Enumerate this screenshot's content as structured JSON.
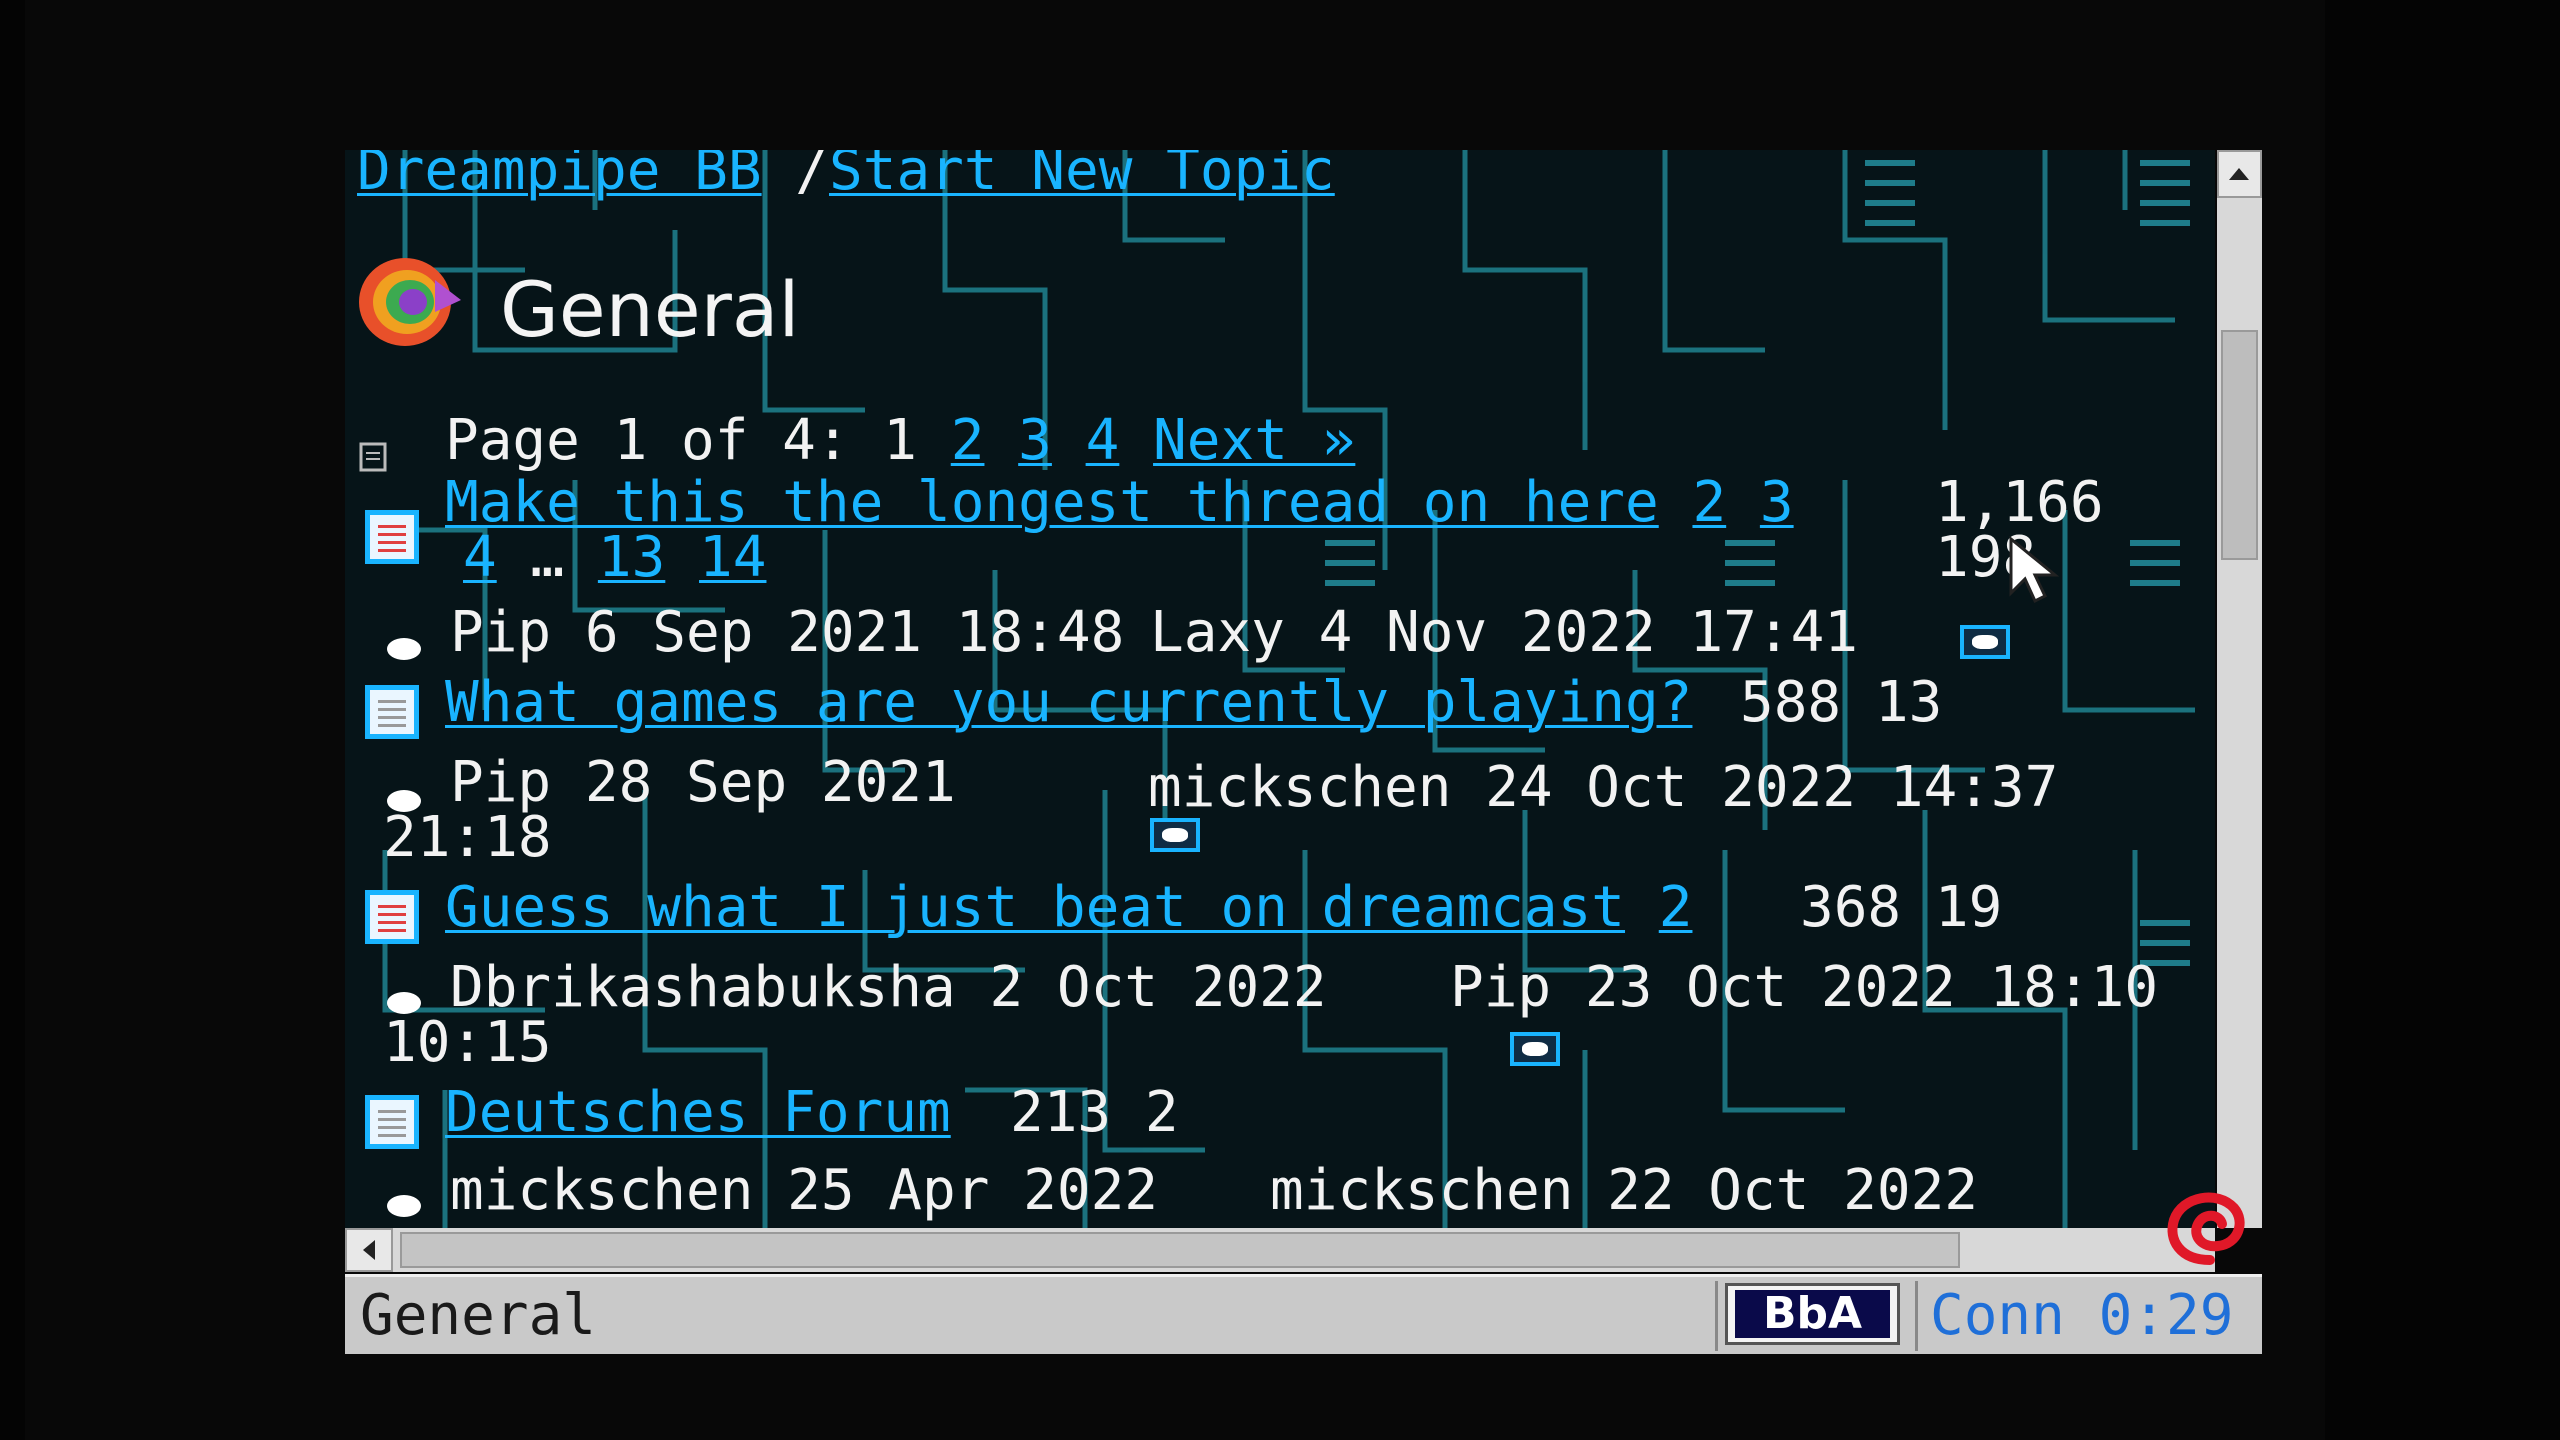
{
  "breadcrumb": {
    "home": "Dreampipe BB",
    "sep": "/",
    "new_topic": "Start New Topic"
  },
  "forum": {
    "title": "General"
  },
  "pager": {
    "text": "Page 1 of 4:",
    "current": "1",
    "pages": [
      "2",
      "3",
      "4"
    ],
    "next": "Next »"
  },
  "topics": [
    {
      "title": "Make this the longest thread on here",
      "pages": [
        "2",
        "3"
      ],
      "pages_line2": [
        "4",
        "…",
        "13",
        "14"
      ],
      "views": "1,166",
      "replies": "198",
      "author": "Pip",
      "started": "6 Sep 2021 18:48",
      "last_author": "Laxy",
      "last_date": "4 Nov 2022 17:41"
    },
    {
      "title": "What games are you currently playing?",
      "views": "588",
      "replies": "13",
      "author": "Pip",
      "started": "28 Sep 2021",
      "started_time": "21:18",
      "last_author": "mickschen",
      "last_date": "24 Oct 2022 14:37"
    },
    {
      "title": "Guess what I just beat on dreamcast",
      "pages": [
        "2"
      ],
      "views": "368",
      "replies": "19",
      "author": "Dbrikashabuksha",
      "started": "2 Oct 2022",
      "started_time": "10:15",
      "last_author": "Pip",
      "last_date": "23 Oct 2022 18:10"
    },
    {
      "title": "Deutsches Forum",
      "views": "213",
      "replies": "2",
      "author": "mickschen",
      "started": "25 Apr 2022",
      "last_author": "mickschen",
      "last_date": "22 Oct 2022"
    }
  ],
  "statusbar": {
    "label": "General",
    "badge": "BbA",
    "conn": "Conn 0:29"
  },
  "colors": {
    "link": "#19b4ff",
    "background": "#061418",
    "circuit": "#1e7c8a"
  }
}
